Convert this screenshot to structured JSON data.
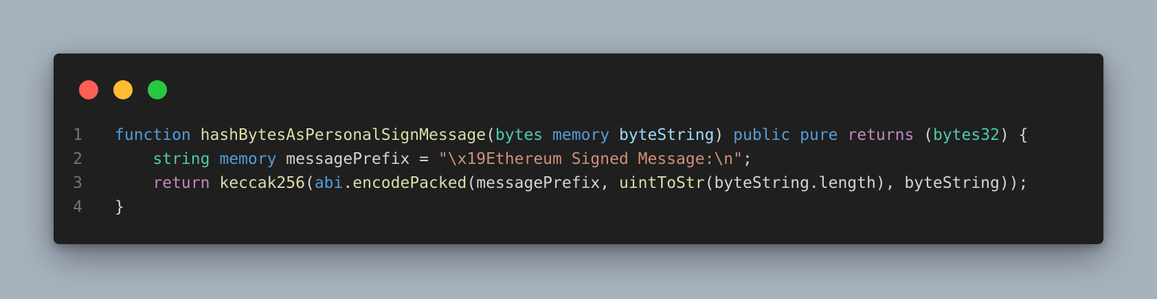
{
  "window": {
    "controls": [
      {
        "name": "close",
        "color": "#ff5f57"
      },
      {
        "name": "minimize",
        "color": "#febc2e"
      },
      {
        "name": "maximize",
        "color": "#28c840"
      }
    ]
  },
  "theme": {
    "keyword": "#569cd6",
    "type": "#4ec9b0",
    "function": "#dcdcaa",
    "control": "#c586c0",
    "param": "#9cdcfe",
    "string": "#ce9178",
    "punct": "#d4d4d4",
    "line_number": "#6e7681"
  },
  "code_lines": [
    {
      "number": "1",
      "tokens": [
        {
          "text": "function",
          "kind": "keyword"
        },
        {
          "text": " ",
          "kind": "punct"
        },
        {
          "text": "hashBytesAsPersonalSignMessage",
          "kind": "function"
        },
        {
          "text": "(",
          "kind": "punct"
        },
        {
          "text": "bytes",
          "kind": "type"
        },
        {
          "text": " ",
          "kind": "punct"
        },
        {
          "text": "memory",
          "kind": "keyword"
        },
        {
          "text": " ",
          "kind": "punct"
        },
        {
          "text": "byteString",
          "kind": "param"
        },
        {
          "text": ") ",
          "kind": "punct"
        },
        {
          "text": "public",
          "kind": "keyword"
        },
        {
          "text": " ",
          "kind": "punct"
        },
        {
          "text": "pure",
          "kind": "keyword"
        },
        {
          "text": " ",
          "kind": "punct"
        },
        {
          "text": "returns",
          "kind": "control"
        },
        {
          "text": " (",
          "kind": "punct"
        },
        {
          "text": "bytes32",
          "kind": "type"
        },
        {
          "text": ") {",
          "kind": "punct"
        }
      ]
    },
    {
      "number": "2",
      "tokens": [
        {
          "text": "    ",
          "kind": "punct"
        },
        {
          "text": "string",
          "kind": "type"
        },
        {
          "text": " ",
          "kind": "punct"
        },
        {
          "text": "memory",
          "kind": "keyword"
        },
        {
          "text": " messagePrefix = ",
          "kind": "punct"
        },
        {
          "text": "\"\\x19Ethereum Signed Message:\\n\"",
          "kind": "string"
        },
        {
          "text": ";",
          "kind": "punct"
        }
      ]
    },
    {
      "number": "3",
      "tokens": [
        {
          "text": "    ",
          "kind": "punct"
        },
        {
          "text": "return",
          "kind": "control"
        },
        {
          "text": " ",
          "kind": "punct"
        },
        {
          "text": "keccak256",
          "kind": "function"
        },
        {
          "text": "(",
          "kind": "punct"
        },
        {
          "text": "abi",
          "kind": "keyword"
        },
        {
          "text": ".",
          "kind": "punct"
        },
        {
          "text": "encodePacked",
          "kind": "function"
        },
        {
          "text": "(messagePrefix, ",
          "kind": "punct"
        },
        {
          "text": "uintToStr",
          "kind": "function"
        },
        {
          "text": "(byteString.length), byteString));",
          "kind": "punct"
        }
      ]
    },
    {
      "number": "4",
      "tokens": [
        {
          "text": "}",
          "kind": "punct"
        }
      ]
    }
  ]
}
